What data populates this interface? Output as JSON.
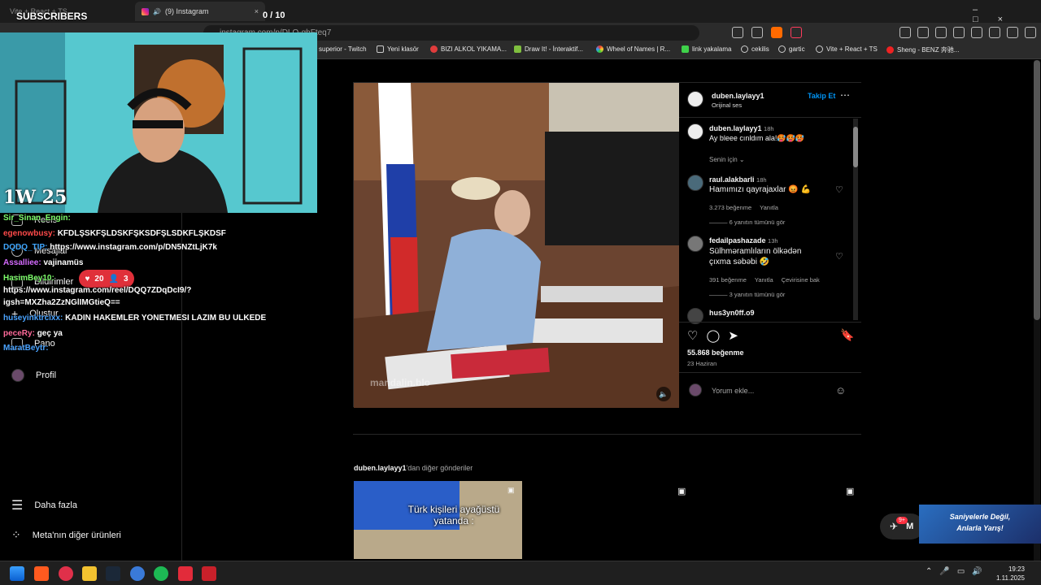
{
  "browser": {
    "tab_active_title": "(9) Instagram",
    "tab_prev_title": "Vite + React + TS",
    "url": "instagram.com/p/DLO-ghFteq7",
    "bookmarks": [
      "superior - Twitch",
      "Yeni klasör",
      "BIZI ALKOL YIKAMA...",
      "Draw It! - İnteraktif...",
      "Wheel of Names | R...",
      "link yakalama",
      "cekilis",
      "gartic",
      "Vite + React + TS",
      "Sheng - BENZ 奔驰..."
    ]
  },
  "stream": {
    "subscribers_label": "SUBSCRIBERS",
    "sub_count": "0 / 10",
    "win_counter": "1W 25",
    "likes": "20",
    "viewers": "3",
    "chat": [
      {
        "user": "Sir_Sinan_Engin:",
        "text": "",
        "color": "#7cfc6a"
      },
      {
        "user": "egenowbusy:",
        "text": "KFDLŞSKFŞLDSKFŞKSDFŞLSDKFLŞKDSF",
        "color": "#ff4a4a"
      },
      {
        "user": "DQDQ_TIP:",
        "text": "https://www.instagram.com/p/DN5NZtLjK7k",
        "color": "#3fa7ff"
      },
      {
        "user": "Assalliee:",
        "text": "vajinamüs",
        "color": "#d56bff"
      },
      {
        "user": "HasimBey10:",
        "text": "",
        "color": "#7cfc6a"
      },
      {
        "user": "",
        "text": "https://www.instagram.com/reel/DQQ7ZDqDcI9/?",
        "color": "#fff"
      },
      {
        "user": "",
        "text": "igsh=MXZha2ZzNGlIMGtieQ==",
        "color": "#fff"
      },
      {
        "user": "huseyinktrcixx:",
        "text": "KADIN HAKEMLER YONETMESI LAZIM BU ULKEDE",
        "color": "#4aa3ff"
      },
      {
        "user": "peceRy:",
        "text": "geç ya",
        "color": "#ff6a9a"
      },
      {
        "user": "MaratBeytr:",
        "text": "",
        "color": "#4aa3ff"
      }
    ]
  },
  "sidebar": {
    "items": [
      {
        "label": "Reels",
        "icon": "reels-icon"
      },
      {
        "label": "Mesajlar",
        "icon": "messages-icon"
      },
      {
        "label": "Bildirimler",
        "icon": "heart-icon"
      },
      {
        "label": "Oluştur",
        "icon": "plus-icon"
      },
      {
        "label": "Pano",
        "icon": "dashboard-icon"
      },
      {
        "label": "Profil",
        "icon": "avatar"
      }
    ],
    "more": "Daha fazla",
    "meta": "Meta'nın diğer ürünleri"
  },
  "post": {
    "author": "duben.laylayy1",
    "audio": "Orijinal ses",
    "follow": "Takip Et",
    "video_watermark": "mandalin.blo",
    "caption": {
      "user": "duben.laylayy1",
      "time": "18h",
      "text": "Ay bleee cınldım ala!🥵🥵🥵"
    },
    "for_you": "Senin için",
    "comments": [
      {
        "user": "raul.alakbarli",
        "time": "18h",
        "text": "Hamımızı qayrajaxlar 😡 💪",
        "likes": "3.273 beğenme",
        "reply": "Yanıtla",
        "more": "6 yanıtın tümünü gör"
      },
      {
        "user": "fedailpashazade",
        "time": "13h",
        "text": "Sülhməramlıların ölkədən çıxma səbəbi 🤣",
        "likes": "391 beğenme",
        "reply": "Yanıtla",
        "translate": "Çevirisine bak",
        "more": "3 yanıtın tümünü gör"
      },
      {
        "user": "hus3yn0ff.o9",
        "time": "",
        "text": ""
      }
    ],
    "likes_count": "55.868 beğenme",
    "date": "23 Haziran",
    "comment_placeholder": "Yorum ekle..."
  },
  "more_posts": {
    "author": "duben.laylayy1",
    "suffix": "'dan diğer gönderiler",
    "thumb_text_1": "Türk kişileri ayağüstü",
    "thumb_text_2": "yatanda :"
  },
  "messages_fab": {
    "badge": "9+",
    "label": "M"
  },
  "ad_banner": {
    "line1": "Saniyelerle Değil,",
    "line2": "Anlarla Yarış!"
  },
  "taskbar": {
    "time": "19:23",
    "date": "1.11.2025"
  }
}
